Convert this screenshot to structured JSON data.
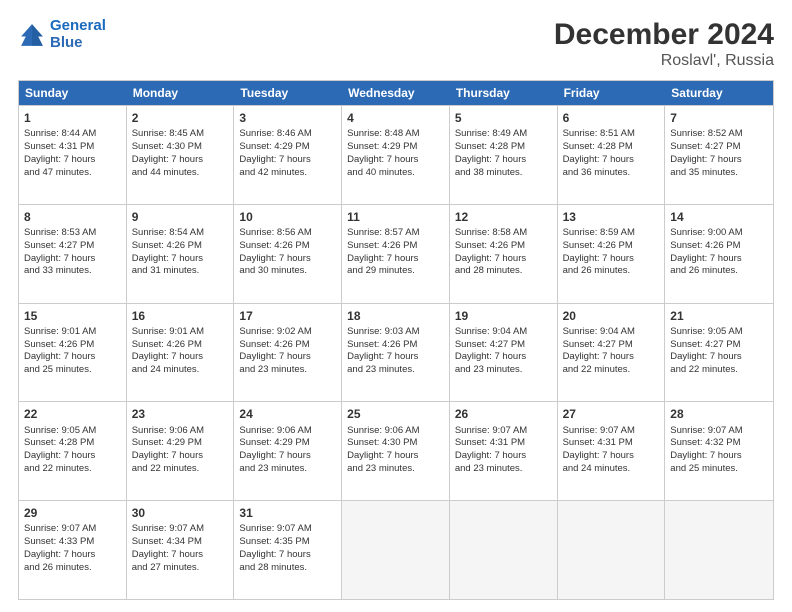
{
  "logo": {
    "line1": "General",
    "line2": "Blue"
  },
  "title": "December 2024",
  "subtitle": "Roslavl', Russia",
  "header_days": [
    "Sunday",
    "Monday",
    "Tuesday",
    "Wednesday",
    "Thursday",
    "Friday",
    "Saturday"
  ],
  "rows": [
    [
      {
        "day": "1",
        "info": "Sunrise: 8:44 AM\nSunset: 4:31 PM\nDaylight: 7 hours\nand 47 minutes."
      },
      {
        "day": "2",
        "info": "Sunrise: 8:45 AM\nSunset: 4:30 PM\nDaylight: 7 hours\nand 44 minutes."
      },
      {
        "day": "3",
        "info": "Sunrise: 8:46 AM\nSunset: 4:29 PM\nDaylight: 7 hours\nand 42 minutes."
      },
      {
        "day": "4",
        "info": "Sunrise: 8:48 AM\nSunset: 4:29 PM\nDaylight: 7 hours\nand 40 minutes."
      },
      {
        "day": "5",
        "info": "Sunrise: 8:49 AM\nSunset: 4:28 PM\nDaylight: 7 hours\nand 38 minutes."
      },
      {
        "day": "6",
        "info": "Sunrise: 8:51 AM\nSunset: 4:28 PM\nDaylight: 7 hours\nand 36 minutes."
      },
      {
        "day": "7",
        "info": "Sunrise: 8:52 AM\nSunset: 4:27 PM\nDaylight: 7 hours\nand 35 minutes."
      }
    ],
    [
      {
        "day": "8",
        "info": "Sunrise: 8:53 AM\nSunset: 4:27 PM\nDaylight: 7 hours\nand 33 minutes."
      },
      {
        "day": "9",
        "info": "Sunrise: 8:54 AM\nSunset: 4:26 PM\nDaylight: 7 hours\nand 31 minutes."
      },
      {
        "day": "10",
        "info": "Sunrise: 8:56 AM\nSunset: 4:26 PM\nDaylight: 7 hours\nand 30 minutes."
      },
      {
        "day": "11",
        "info": "Sunrise: 8:57 AM\nSunset: 4:26 PM\nDaylight: 7 hours\nand 29 minutes."
      },
      {
        "day": "12",
        "info": "Sunrise: 8:58 AM\nSunset: 4:26 PM\nDaylight: 7 hours\nand 28 minutes."
      },
      {
        "day": "13",
        "info": "Sunrise: 8:59 AM\nSunset: 4:26 PM\nDaylight: 7 hours\nand 26 minutes."
      },
      {
        "day": "14",
        "info": "Sunrise: 9:00 AM\nSunset: 4:26 PM\nDaylight: 7 hours\nand 26 minutes."
      }
    ],
    [
      {
        "day": "15",
        "info": "Sunrise: 9:01 AM\nSunset: 4:26 PM\nDaylight: 7 hours\nand 25 minutes."
      },
      {
        "day": "16",
        "info": "Sunrise: 9:01 AM\nSunset: 4:26 PM\nDaylight: 7 hours\nand 24 minutes."
      },
      {
        "day": "17",
        "info": "Sunrise: 9:02 AM\nSunset: 4:26 PM\nDaylight: 7 hours\nand 23 minutes."
      },
      {
        "day": "18",
        "info": "Sunrise: 9:03 AM\nSunset: 4:26 PM\nDaylight: 7 hours\nand 23 minutes."
      },
      {
        "day": "19",
        "info": "Sunrise: 9:04 AM\nSunset: 4:27 PM\nDaylight: 7 hours\nand 23 minutes."
      },
      {
        "day": "20",
        "info": "Sunrise: 9:04 AM\nSunset: 4:27 PM\nDaylight: 7 hours\nand 22 minutes."
      },
      {
        "day": "21",
        "info": "Sunrise: 9:05 AM\nSunset: 4:27 PM\nDaylight: 7 hours\nand 22 minutes."
      }
    ],
    [
      {
        "day": "22",
        "info": "Sunrise: 9:05 AM\nSunset: 4:28 PM\nDaylight: 7 hours\nand 22 minutes."
      },
      {
        "day": "23",
        "info": "Sunrise: 9:06 AM\nSunset: 4:29 PM\nDaylight: 7 hours\nand 22 minutes."
      },
      {
        "day": "24",
        "info": "Sunrise: 9:06 AM\nSunset: 4:29 PM\nDaylight: 7 hours\nand 23 minutes."
      },
      {
        "day": "25",
        "info": "Sunrise: 9:06 AM\nSunset: 4:30 PM\nDaylight: 7 hours\nand 23 minutes."
      },
      {
        "day": "26",
        "info": "Sunrise: 9:07 AM\nSunset: 4:31 PM\nDaylight: 7 hours\nand 23 minutes."
      },
      {
        "day": "27",
        "info": "Sunrise: 9:07 AM\nSunset: 4:31 PM\nDaylight: 7 hours\nand 24 minutes."
      },
      {
        "day": "28",
        "info": "Sunrise: 9:07 AM\nSunset: 4:32 PM\nDaylight: 7 hours\nand 25 minutes."
      }
    ],
    [
      {
        "day": "29",
        "info": "Sunrise: 9:07 AM\nSunset: 4:33 PM\nDaylight: 7 hours\nand 26 minutes."
      },
      {
        "day": "30",
        "info": "Sunrise: 9:07 AM\nSunset: 4:34 PM\nDaylight: 7 hours\nand 27 minutes."
      },
      {
        "day": "31",
        "info": "Sunrise: 9:07 AM\nSunset: 4:35 PM\nDaylight: 7 hours\nand 28 minutes."
      },
      {
        "day": "",
        "info": ""
      },
      {
        "day": "",
        "info": ""
      },
      {
        "day": "",
        "info": ""
      },
      {
        "day": "",
        "info": ""
      }
    ]
  ]
}
